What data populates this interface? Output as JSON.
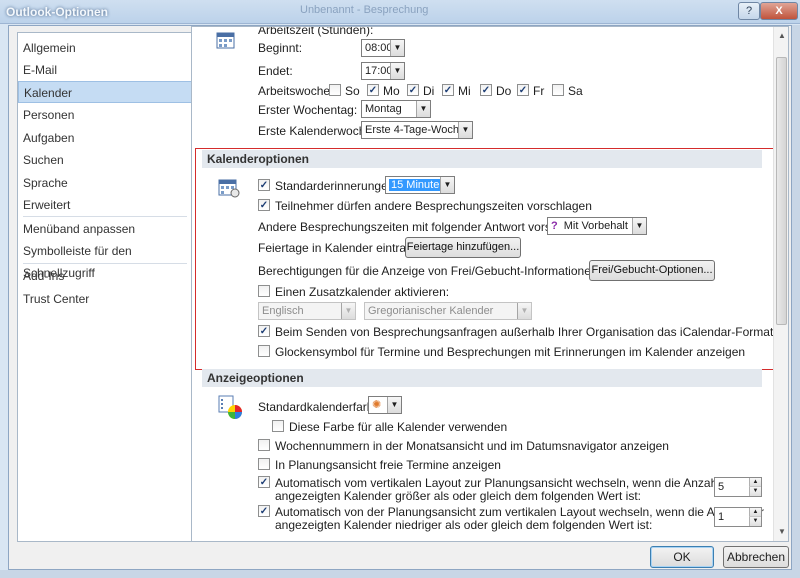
{
  "window": {
    "title": "Outlook-Optionen",
    "background_title": "Unbenannt - Besprechung",
    "help_label": "?",
    "close_label": "X"
  },
  "sidebar": {
    "items": [
      {
        "label": "Allgemein"
      },
      {
        "label": "E-Mail"
      },
      {
        "label": "Kalender",
        "selected": true
      },
      {
        "label": "Personen"
      },
      {
        "label": "Aufgaben"
      },
      {
        "label": "Suchen"
      },
      {
        "label": "Sprache"
      },
      {
        "label": "Erweitert"
      },
      {
        "label": "Menüband anpassen"
      },
      {
        "label": "Symbolleiste für den Schnellzugriff"
      },
      {
        "label": "Add-Ins"
      },
      {
        "label": "Trust Center"
      }
    ]
  },
  "arbeitszeit": {
    "header_cut": "Arbeitszeit (Stunden):",
    "begin_label": "Beginnt:",
    "begin_value": "08:00",
    "end_label": "Endet:",
    "end_value": "17:00",
    "week_label": "Arbeitswoche:",
    "days": [
      {
        "label": "So",
        "checked": false
      },
      {
        "label": "Mo",
        "checked": true
      },
      {
        "label": "Di",
        "checked": true
      },
      {
        "label": "Mi",
        "checked": true
      },
      {
        "label": "Do",
        "checked": true
      },
      {
        "label": "Fr",
        "checked": true
      },
      {
        "label": "Sa",
        "checked": false
      }
    ],
    "first_day_label": "Erster Wochentag:",
    "first_day_value": "Montag",
    "first_week_label": "Erste Kalenderwoche:",
    "first_week_value": "Erste 4-Tage-Woche"
  },
  "kalenderoptionen": {
    "header": "Kalenderoptionen",
    "reminder_label": "Standarderinnerungen:",
    "reminder_checked": true,
    "reminder_value": "15 Minuten",
    "propose_label": "Teilnehmer dürfen andere Besprechungszeiten vorschlagen",
    "propose_checked": true,
    "response_label": "Andere Besprechungszeiten mit folgender Antwort vorschlagen:",
    "response_icon": "?",
    "response_value": "Mit Vorbehalt",
    "holidays_label": "Feiertage in Kalender eintragen:",
    "holidays_button": "Feiertage hinzufügen...",
    "freebusy_label": "Berechtigungen für die Anzeige von Frei/Gebucht-Informationen ändern:",
    "freebusy_button": "Frei/Gebucht-Optionen...",
    "alt_cal_label": "Einen Zusatzkalender aktivieren:",
    "alt_cal_checked": false,
    "alt_cal_language": "Englisch",
    "alt_cal_type": "Gregorianischer Kalender",
    "icalendar_label": "Beim Senden von Besprechungsanfragen außerhalb Ihrer Organisation das iCalendar-Format verwenden",
    "icalendar_checked": true,
    "bell_label": "Glockensymbol für Termine und Besprechungen mit Erinnerungen im Kalender anzeigen",
    "bell_checked": false
  },
  "anzeigeoptionen": {
    "header": "Anzeigeoptionen",
    "color_label": "Standardkalenderfarbe:",
    "all_color_label": "Diese Farbe für alle Kalender verwenden",
    "all_color_checked": false,
    "weeknum_label": "Wochennummern in der Monatsansicht und im Datumsnavigator anzeigen",
    "weeknum_checked": false,
    "free_time_label": "In Planungsansicht freie Termine anzeigen",
    "free_time_checked": false,
    "auto_schedule_line1": "Automatisch vom vertikalen Layout zur Planungsansicht wechseln, wenn die Anzahl der",
    "auto_schedule_line2": "angezeigten Kalender größer als oder gleich dem folgenden Wert ist:",
    "auto_schedule_checked": true,
    "auto_schedule_value": "5",
    "auto_vertical_line1": "Automatisch von der Planungsansicht zum vertikalen Layout wechseln, wenn die Anzahl der",
    "auto_vertical_line2": "angezeigten Kalender niedriger als oder gleich dem folgenden Wert ist:",
    "auto_vertical_checked": true,
    "auto_vertical_value": "1"
  },
  "footer": {
    "ok_label": "OK",
    "cancel_label": "Abbrechen"
  },
  "colors": {
    "selection": "#c5dcf3",
    "highlight_box": "#d42c2c"
  }
}
